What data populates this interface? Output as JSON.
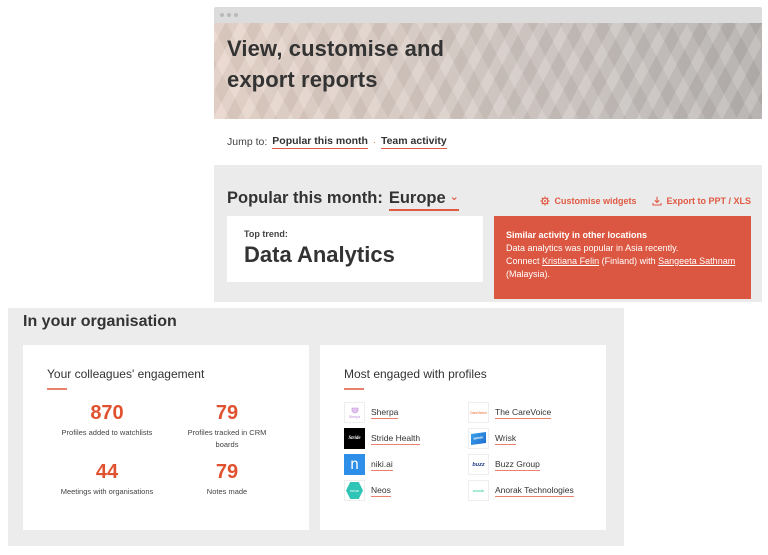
{
  "browser": {
    "hero_title": "View, customise and export reports",
    "jump": {
      "label": "Jump to:",
      "links": [
        "Popular this month",
        "Team activity"
      ],
      "separator": "·"
    }
  },
  "popular": {
    "heading": "Popular this month:",
    "region": "Europe",
    "actions": {
      "customise": "Customise widgets",
      "export": "Export to PPT / XLS"
    },
    "trend": {
      "label": "Top trend:",
      "value": "Data Analytics"
    },
    "similar": {
      "title": "Similar activity in other locations",
      "line1": "Data analytics was popular in Asia recently.",
      "connect": "Connect",
      "person1": "Kristiana Felin",
      "person1_loc": "(Finland) with",
      "person2": "Sangeeta Sathnam",
      "person2_loc": "(Malaysia)."
    }
  },
  "organisation": {
    "title": "In your organisation",
    "engagement": {
      "title": "Your colleagues' engagement",
      "stats": [
        {
          "value": "870",
          "label": "Profiles added to watchlists"
        },
        {
          "value": "79",
          "label": "Profiles tracked in CRM boards"
        },
        {
          "value": "44",
          "label": "Meetings with organisations"
        },
        {
          "value": "79",
          "label": "Notes made"
        }
      ]
    },
    "profiles": {
      "title": "Most engaged with profiles",
      "items": [
        {
          "name": "Sherpa",
          "logo": "Sherpa"
        },
        {
          "name": "The CareVoice",
          "logo": "CareVoice"
        },
        {
          "name": "Stride Health",
          "logo": "Stride"
        },
        {
          "name": "Wrisk",
          "logo": "WRISK"
        },
        {
          "name": "niki.ai",
          "logo": "n"
        },
        {
          "name": "Buzz Group",
          "logo": "buzz"
        },
        {
          "name": "Neos",
          "logo": "neos"
        },
        {
          "name": "Anorak Technologies",
          "logo": "anorak"
        }
      ]
    }
  },
  "colors": {
    "accent": "#e05a43",
    "similar_card": "#dc5741",
    "stat_value": "#e0522f",
    "panel_bg": "#ebebeb"
  }
}
